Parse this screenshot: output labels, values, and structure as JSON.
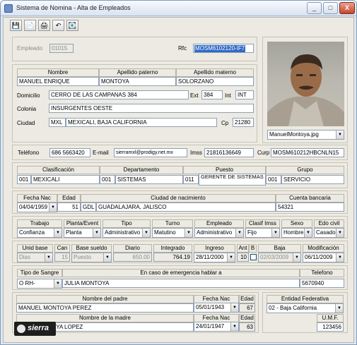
{
  "window": {
    "title": "Sistema de Nomina - Alta de Empleados",
    "min": "_",
    "max": "□",
    "close": "X"
  },
  "toolbar": [
    "💾",
    "📄",
    "🖨",
    "↶",
    "💽"
  ],
  "empleado": {
    "label": "Empleado",
    "value": "01015",
    "rfc_label": "Rfc",
    "rfc_value": "MOSM6102120-IF7"
  },
  "nombre": {
    "h_nombre": "Nombre",
    "h_paterno": "Apellido paterno",
    "h_materno": "Apellido materno",
    "nombre": "MANUEL ENRIQUE",
    "paterno": "MONTOYA",
    "materno": "SOLORZANO"
  },
  "domicilio": {
    "label": "Domicilio",
    "value": "CERRO DE LAS CAMPANAS 384",
    "ext_label": "Ext",
    "ext": "384",
    "int_label": "Int",
    "int": "INT"
  },
  "colonia": {
    "label": "Colonia",
    "value": "INSURGENTES OESTE"
  },
  "ciudad": {
    "label": "Ciudad",
    "code": "MXL",
    "value": "MEXICALI, BAJA CALIFORNIA",
    "cp_label": "Cp",
    "cp": "21280"
  },
  "photo": {
    "file": "ManuelMontoya.jpg"
  },
  "contacto": {
    "tel_label": "Teléfono",
    "tel": "686 5663420",
    "email_label": "E-mail",
    "email": "sierramxl@prodigy.net.mx",
    "imss_label": "Imss",
    "imss": "21816136649",
    "curp_label": "Curp",
    "curp": "MOSM610212HBCNLN15"
  },
  "clasif": {
    "h_clasif": "Clasificación",
    "h_depto": "Departamento",
    "h_puesto": "Puesto",
    "h_grupo": "Grupo",
    "clasif_code": "001",
    "clasif": "MEXICALI",
    "depto_code": "001",
    "depto": "SISTEMAS",
    "puesto_code": "011",
    "puesto": "GERENTE DE SISTEMAS",
    "grupo_code": "001",
    "grupo": "SERVICIO"
  },
  "nacimiento": {
    "h_fecha": "Fecha Nac",
    "h_edad": "Edad",
    "h_ciudad": "Ciudad de nacimiento",
    "h_cuenta": "Cuenta bancaria",
    "fecha": "04/04/1959",
    "edad": "51",
    "code": "GDL",
    "ciudad": "GUADALAJARA, JALISCO",
    "cuenta": "54321"
  },
  "trabajo": {
    "h_trabajo": "Trabajo",
    "h_planta": "Planta/Event",
    "h_tipo": "Tipo",
    "h_turno": "Turno",
    "h_empleado": "Empleado",
    "h_clasif_imss": "Clasif Imss",
    "h_sexo": "Sexo",
    "h_civil": "Edo civil",
    "trabajo": "Confianza",
    "planta": "Planta",
    "tipo": "Administrativo",
    "turno": "Matutino",
    "empleado": "Administrativo",
    "clasif_imss": "Fijo",
    "sexo": "Hombre",
    "civil": "Casado"
  },
  "sueldo": {
    "h_unidad": "Unid base",
    "h_can": "Can",
    "h_base": "Base sueldo",
    "h_diario": "Diario",
    "h_integrado": "Integrado",
    "h_ingreso": "Ingreso",
    "h_ant": "Ant",
    "h_b": "B",
    "h_baja": "Baja",
    "h_mod": "Modificación",
    "unidad": "Dias",
    "can": "15",
    "base": "Puesto",
    "diario": "650.00",
    "integrado": "764.19",
    "ingreso": "28/11/2000",
    "ant": "10",
    "baja": "02/03/2009",
    "mod": "06/11/2009"
  },
  "emergencia": {
    "h_sangre": "Tipo de Sangre",
    "h_contacto": "En caso de emergencia hablar a",
    "h_tel": "Telefono",
    "sangre": "O   RH-",
    "contacto": "JULIA MONTOYA",
    "tel": "5670940"
  },
  "padres": {
    "h_padre": "Nombre del padre",
    "h_fecha": "Fecha Nac",
    "h_edad": "Edad",
    "h_madre": "Nombre de la madre",
    "padre": "MANUEL MONTOYA PEREZ",
    "padre_fecha": "05/01/1943",
    "padre_edad": "67",
    "madre": "JULIA MONTOYA LOPEZ",
    "madre_fecha": "24/01/1947",
    "madre_edad": "63"
  },
  "federativa": {
    "h_entidad": "Entidad Federativa",
    "entidad": "02 - Baja California",
    "h_umf": "U.M.F.",
    "umf": "123456"
  },
  "logo": {
    "text": "sierra"
  }
}
